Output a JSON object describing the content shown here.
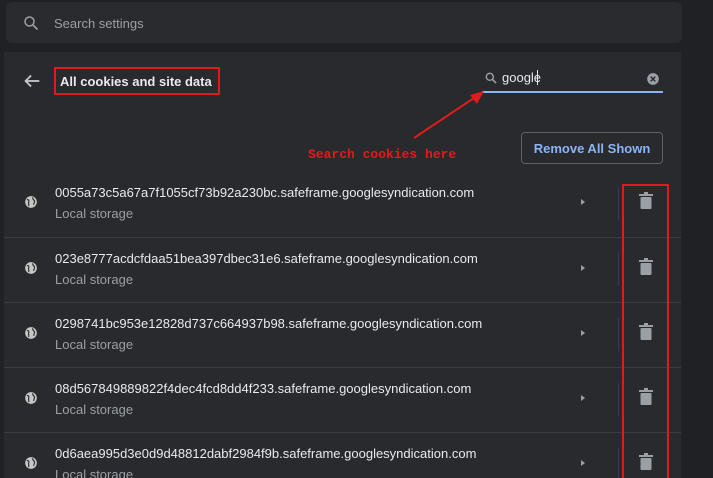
{
  "search": {
    "placeholder": "Search settings",
    "icon": "search-icon"
  },
  "header": {
    "title": "All cookies and site data",
    "filter_value": "google",
    "back_icon": "arrow-back-icon",
    "clear_icon": "clear-icon"
  },
  "annotation": {
    "text": "Search cookies here",
    "color": "#e01b1b"
  },
  "actions": {
    "remove_all_label": "Remove All Shown"
  },
  "cookies": [
    {
      "name": "0055a73c5a67a7f1055cf73b92a230bc.safeframe.googlesyndication.com",
      "type": "Local storage"
    },
    {
      "name": "023e8777acdcfdaa51bea397dbec31e6.safeframe.googlesyndication.com",
      "type": "Local storage"
    },
    {
      "name": "0298741bc953e12828d737c664937b98.safeframe.googlesyndication.com",
      "type": "Local storage"
    },
    {
      "name": "08d567849889822f4dec4fcd8dd4f233.safeframe.googlesyndication.com",
      "type": "Local storage"
    },
    {
      "name": "0d6aea995d3e0d9d48812dabf2984f9b.safeframe.googlesyndication.com",
      "type": "Local storage"
    }
  ],
  "colors": {
    "accent": "#8ab4f8",
    "highlight": "#e01b1b",
    "background": "#202124",
    "card": "#292a2d"
  }
}
